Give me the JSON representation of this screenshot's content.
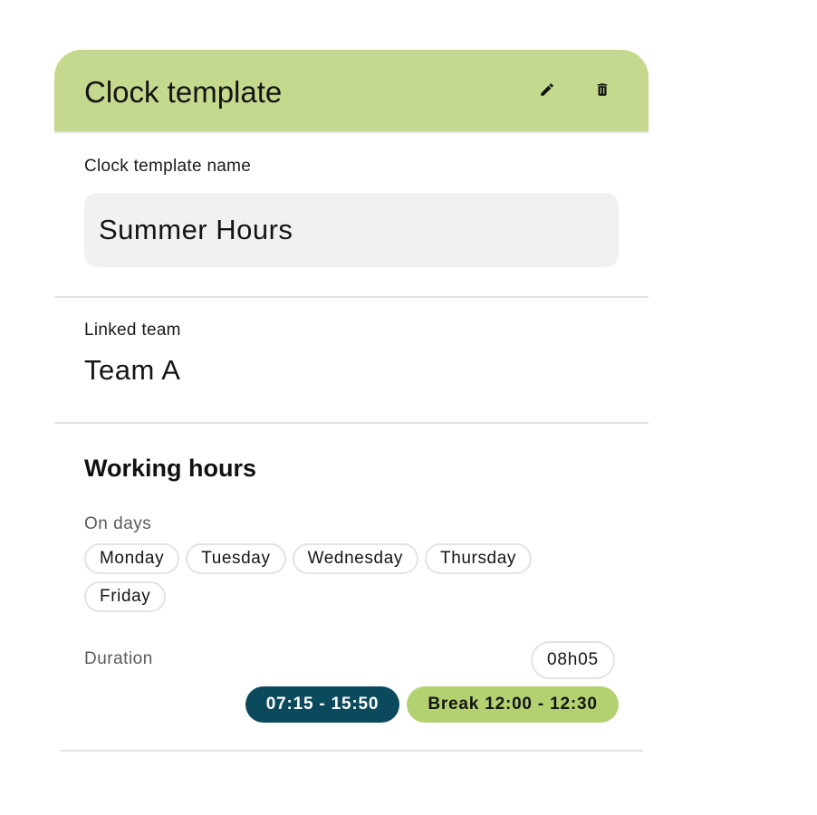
{
  "header": {
    "title": "Clock template",
    "edit_icon": "pencil-icon",
    "delete_icon": "trash-icon",
    "background_color": "#c4d98d"
  },
  "template_name": {
    "label": "Clock template name",
    "value": "Summer Hours"
  },
  "linked_team": {
    "label": "Linked team",
    "value": "Team A"
  },
  "working_hours": {
    "title": "Working hours",
    "days_label": "On days",
    "days": [
      "Monday",
      "Tuesday",
      "Wednesday",
      "Thursday",
      "Friday"
    ],
    "duration_label": "Duration",
    "duration_value": "08h05",
    "time_range": "07:15 - 15:50",
    "break_range": "Break 12:00 - 12:30",
    "time_color": "#0b4a5c",
    "break_color": "#b4d171"
  }
}
